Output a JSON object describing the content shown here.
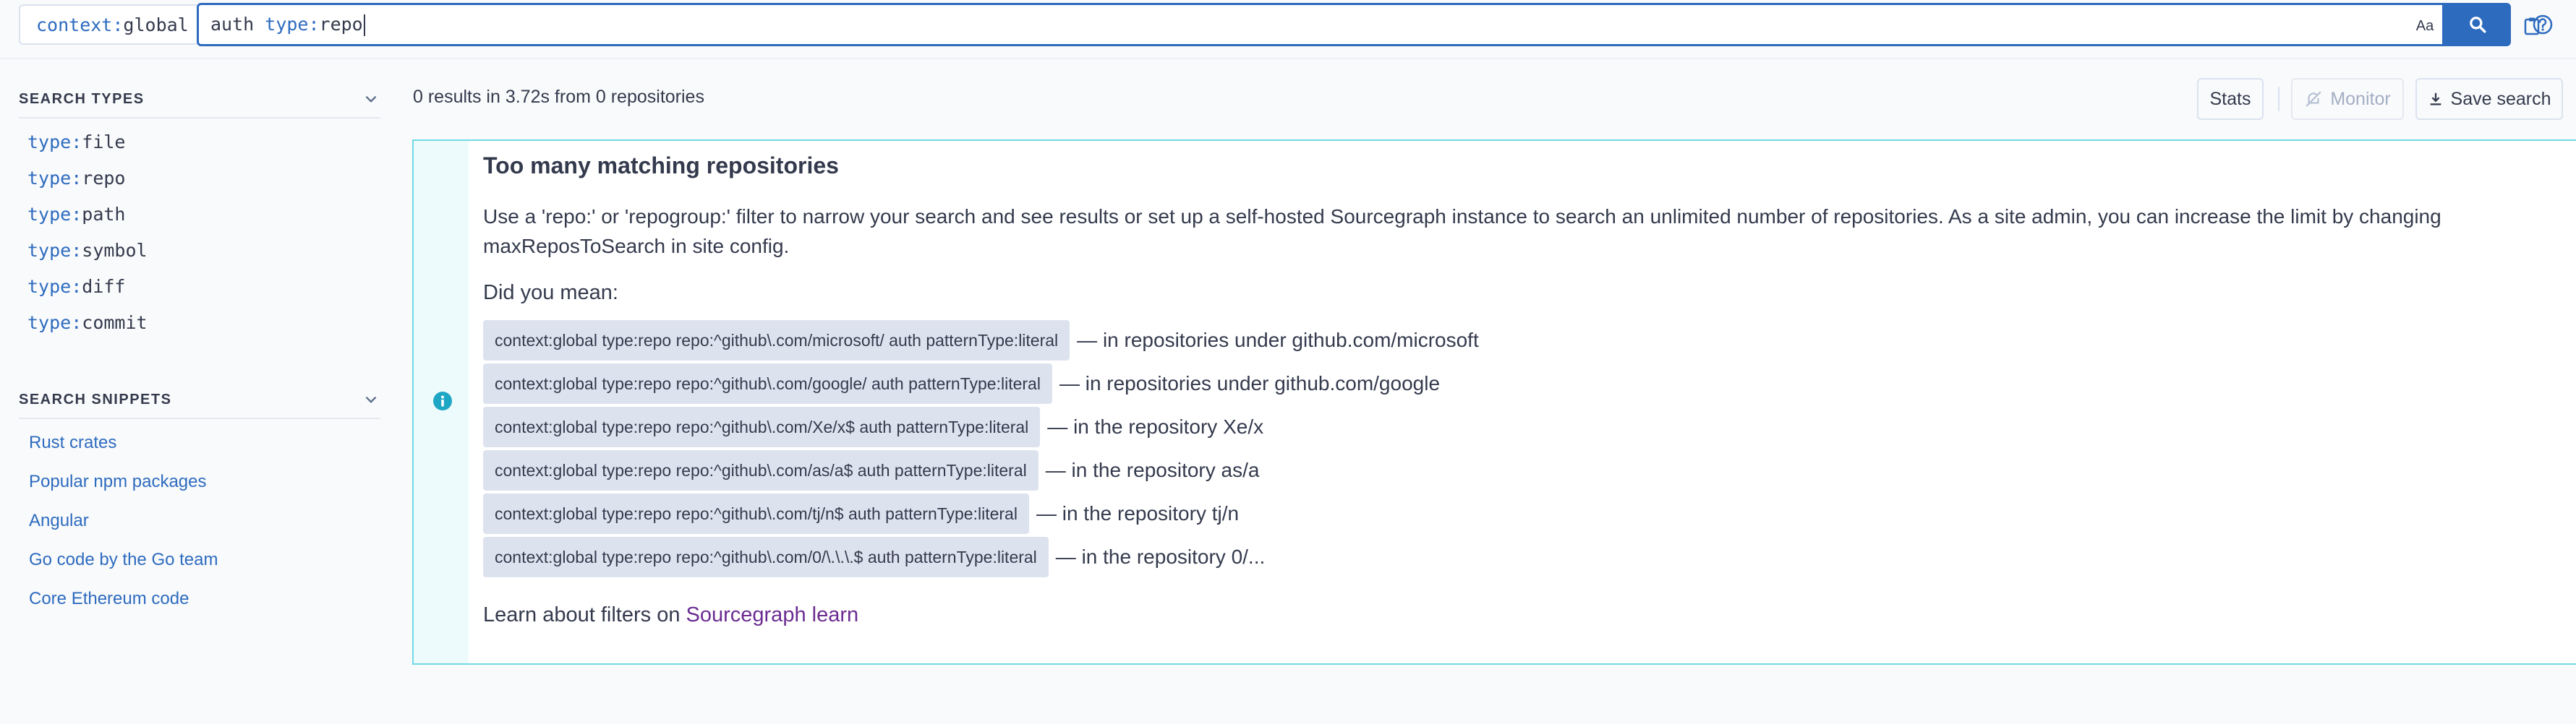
{
  "search_bar": {
    "context_key": "context:",
    "context_value": "global",
    "query_term": "auth ",
    "query_filter_key": "type:",
    "query_filter_value": "repo",
    "case_toggle_label": "Aa",
    "regex_icon": "asterisk-icon",
    "structural_toggle_label": "[]",
    "clipboard_icon": "clipboard-icon",
    "search_icon": "magnifier-icon",
    "help_icon": "question-circle-icon"
  },
  "sidebar": {
    "search_types_title": "SEARCH TYPES",
    "types": [
      {
        "key": "type:",
        "value": "file"
      },
      {
        "key": "type:",
        "value": "repo"
      },
      {
        "key": "type:",
        "value": "path"
      },
      {
        "key": "type:",
        "value": "symbol"
      },
      {
        "key": "type:",
        "value": "diff"
      },
      {
        "key": "type:",
        "value": "commit"
      }
    ],
    "search_snippets_title": "SEARCH SNIPPETS",
    "snippets": [
      "Rust crates",
      "Popular npm packages",
      "Angular",
      "Go code by the Go team",
      "Core Ethereum code"
    ]
  },
  "results": {
    "summary": "0 results in 3.72s from 0 repositories",
    "stats_label": "Stats",
    "monitor_label": "Monitor",
    "save_search_label": "Save search"
  },
  "alert": {
    "title": "Too many matching repositories",
    "description": "Use a 'repo:' or 'repogroup:' filter to narrow your search and see results or set up a self-hosted Sourcegraph instance to search an unlimited number of repositories. As a site admin, you can increase the limit by changing maxReposToSearch in site config.",
    "did_you_mean": "Did you mean:",
    "suggestions": [
      {
        "query": "context:global type:repo repo:^github\\.com/microsoft/ auth patternType:literal",
        "description": "— in repositories under github.com/microsoft"
      },
      {
        "query": "context:global type:repo repo:^github\\.com/google/ auth patternType:literal",
        "description": "— in repositories under github.com/google"
      },
      {
        "query": "context:global type:repo repo:^github\\.com/Xe/x$ auth patternType:literal",
        "description": "— in the repository Xe/x"
      },
      {
        "query": "context:global type:repo repo:^github\\.com/as/a$ auth patternType:literal",
        "description": "— in the repository as/a"
      },
      {
        "query": "context:global type:repo repo:^github\\.com/tj/n$ auth patternType:literal",
        "description": "— in the repository tj/n"
      },
      {
        "query": "context:global type:repo repo:^github\\.com/0/\\.\\.\\.$ auth patternType:literal",
        "description": "— in the repository 0/..."
      }
    ],
    "learn_prefix": "Learn about filters on ",
    "learn_link": "Sourcegraph learn"
  },
  "colors": {
    "accent": "#2d6bbf",
    "alert_border": "#72dbe6",
    "link_purple": "#6b2c91"
  }
}
